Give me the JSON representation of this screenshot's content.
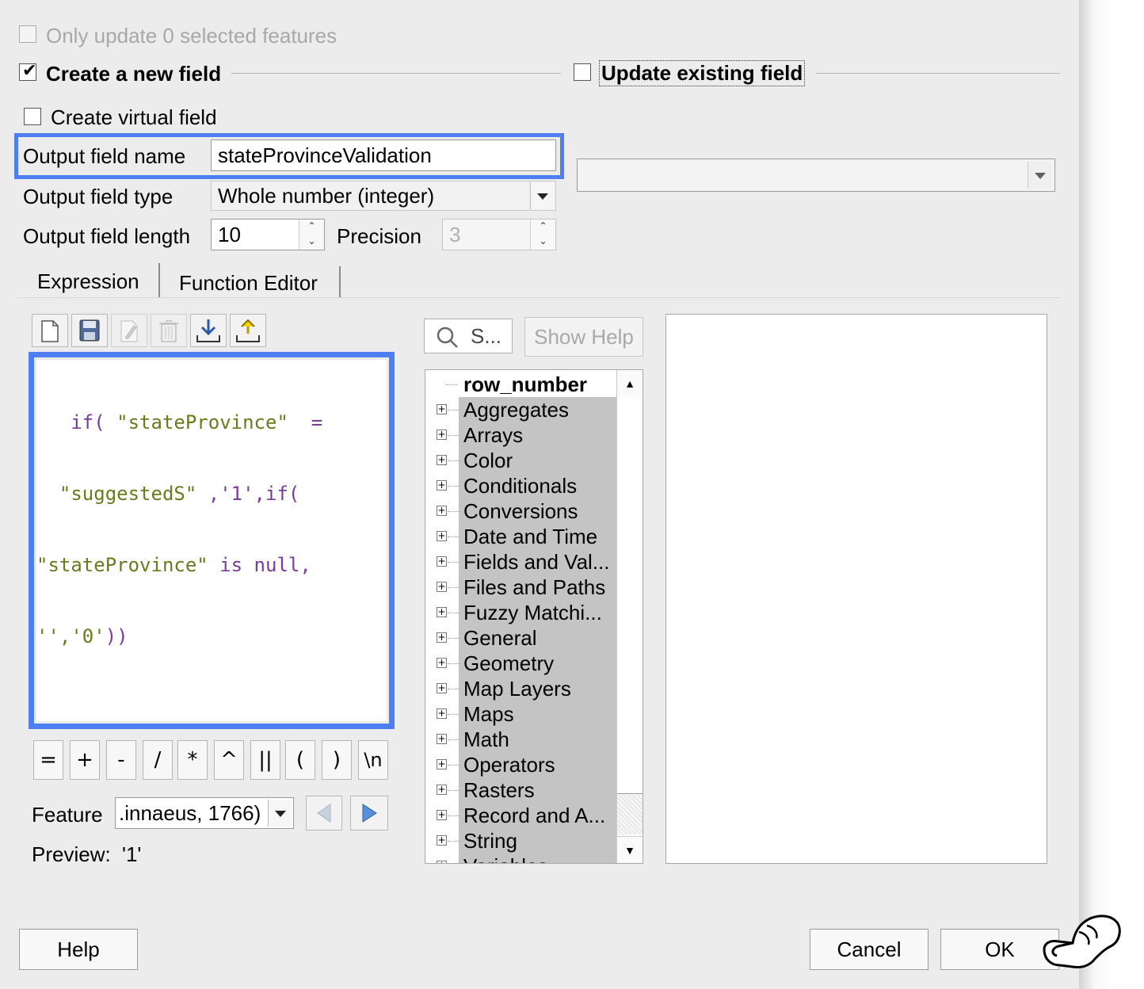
{
  "top": {
    "only_update_label": "Only update 0 selected features",
    "create_new_field_label": "Create a new field",
    "create_new_field_checked": true,
    "update_existing_label": "Update existing field",
    "create_virtual_label": "Create virtual field"
  },
  "form": {
    "output_name_label": "Output field name",
    "output_name_value": "stateProvinceValidation",
    "output_type_label": "Output field type",
    "output_type_value": "Whole number (integer)",
    "output_length_label": "Output field length",
    "output_length_value": "10",
    "precision_label": "Precision",
    "precision_value": "3",
    "existing_field_value": ""
  },
  "tabs": [
    {
      "label": "Expression",
      "active": true
    },
    {
      "label": "Function Editor",
      "active": false
    }
  ],
  "toolbar": {
    "icons": [
      "new-file-icon",
      "save-icon",
      "edit-icon",
      "delete-icon",
      "import-icon",
      "export-icon"
    ]
  },
  "expression": {
    "lines": [
      [
        "   if( ",
        "\"stateProvince\"",
        "  = "
      ],
      [
        "  ",
        "\"suggestedS\"",
        " ,'1',if("
      ],
      [
        "",
        "\"stateProvince\"",
        " is null,"
      ],
      [
        "",
        "'','0'",
        "))"
      ]
    ]
  },
  "operators": [
    "=",
    "+",
    "-",
    "/",
    "*",
    "^",
    "||",
    "(",
    ")",
    "\\n"
  ],
  "feature": {
    "label": "Feature",
    "value": ".innaeus, 1766)",
    "preview_label": "Preview:",
    "preview_value": "'1'"
  },
  "search": {
    "placeholder": "S...",
    "show_help_label": "Show Help"
  },
  "function_tree": {
    "items": [
      "row_number",
      "Aggregates",
      "Arrays",
      "Color",
      "Conditionals",
      "Conversions",
      "Date and Time",
      "Fields and Val...",
      "Files and Paths",
      "Fuzzy Matchi...",
      "General",
      "Geometry",
      "Map Layers",
      "Maps",
      "Math",
      "Operators",
      "Rasters",
      "Record and A...",
      "String",
      "Variables"
    ]
  },
  "buttons": {
    "help": "Help",
    "cancel": "Cancel",
    "ok": "OK"
  },
  "colors": {
    "focus_border": "#4d7ef2",
    "tree_selection": "#c4c4c4",
    "code_string": "#6a7a1e",
    "code_keyword": "#7a3b9a"
  }
}
